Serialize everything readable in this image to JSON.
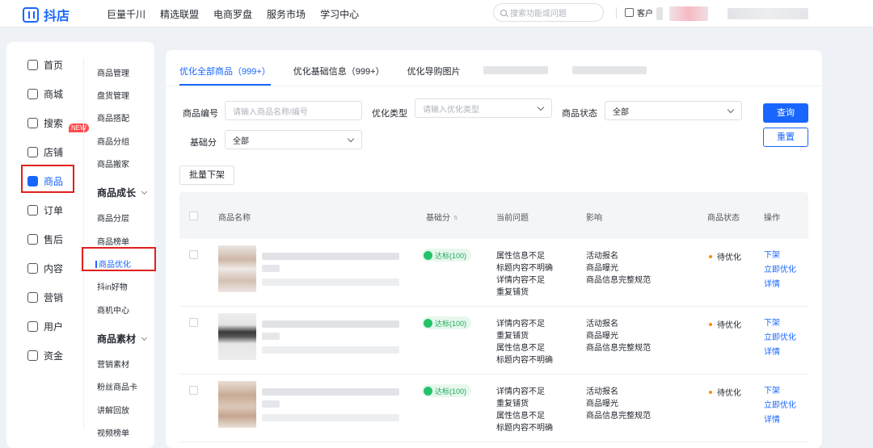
{
  "topbar": {
    "logo_text": "抖店",
    "nav": [
      "巨量千川",
      "精选联盟",
      "电商罗盘",
      "服务市场",
      "学习中心"
    ],
    "search_placeholder": "搜索功能或问题",
    "client_label": "客户"
  },
  "sidebar": {
    "primary": [
      {
        "label": "首页",
        "icon": "home-icon"
      },
      {
        "label": "商城",
        "icon": "store-icon",
        "badge": "NEW"
      },
      {
        "label": "搜索",
        "icon": "search-icon"
      },
      {
        "label": "店铺",
        "icon": "shop-icon"
      },
      {
        "label": "商品",
        "icon": "product-icon",
        "active": true
      },
      {
        "label": "订单",
        "icon": "order-icon"
      },
      {
        "label": "售后",
        "icon": "after-sales-icon"
      },
      {
        "label": "内容",
        "icon": "content-icon"
      },
      {
        "label": "营销",
        "icon": "marketing-icon"
      },
      {
        "label": "用户",
        "icon": "user-icon"
      },
      {
        "label": "资金",
        "icon": "funds-icon"
      }
    ],
    "secondary": [
      {
        "label": "商品管理"
      },
      {
        "label": "盘货管理"
      },
      {
        "label": "商品搭配"
      },
      {
        "label": "商品分组"
      },
      {
        "label": "商品搬家"
      },
      {
        "label": "商品成长",
        "group": true
      },
      {
        "label": "商品分层"
      },
      {
        "label": "商品榜单"
      },
      {
        "label": "商品优化",
        "active": true
      },
      {
        "label": "抖in好物"
      },
      {
        "label": "商机中心"
      },
      {
        "label": "商品素材",
        "group": true
      },
      {
        "label": "营销素材"
      },
      {
        "label": "粉丝商品卡"
      },
      {
        "label": "讲解回放"
      },
      {
        "label": "视频榜单"
      }
    ]
  },
  "tabs": [
    {
      "label": "优化全部商品（999+）",
      "active": true
    },
    {
      "label": "优化基础信息（999+）"
    },
    {
      "label": "优化导购图片"
    }
  ],
  "filters": {
    "product_id_label": "商品编号",
    "product_id_placeholder": "请输入商品名称/编号",
    "opt_type_label": "优化类型",
    "opt_type_placeholder": "请输入优化类型",
    "status_label": "商品状态",
    "status_value": "全部",
    "score_label": "基础分",
    "score_value": "全部",
    "query_button": "查询",
    "reset_button": "重置",
    "batch_button": "批量下架"
  },
  "table": {
    "headers": {
      "name": "商品名称",
      "score": "基础分",
      "issues": "当前问题",
      "effect": "影响",
      "status": "商品状态",
      "actions": "操作"
    },
    "rows": [
      {
        "score": "达标(100)",
        "issues": [
          "属性信息不足",
          "标题内容不明确",
          "详情内容不足",
          "重复铺货"
        ],
        "effects": [
          "活动报名",
          "商品曝光",
          "商品信息完整规范"
        ],
        "status": "待优化",
        "actions": [
          "下架",
          "立即优化",
          "详情"
        ]
      },
      {
        "score": "达标(100)",
        "issues": [
          "详情内容不足",
          "重复铺货",
          "属性信息不足",
          "标题内容不明确"
        ],
        "effects": [
          "活动报名",
          "商品曝光",
          "商品信息完整规范"
        ],
        "status": "待优化",
        "actions": [
          "下架",
          "立即优化",
          "详情"
        ]
      },
      {
        "score": "达标(100)",
        "issues": [
          "详情内容不足",
          "重复铺货",
          "属性信息不足",
          "标题内容不明确"
        ],
        "effects": [
          "活动报名",
          "商品曝光",
          "商品信息完整规范"
        ],
        "status": "待优化",
        "actions": [
          "下架",
          "立即优化",
          "详情"
        ]
      }
    ]
  },
  "colors": {
    "accent": "#1966ff",
    "highlight_box": "#e02020",
    "pending_dot": "#ff8a00",
    "pass_green": "#1aab5c"
  }
}
